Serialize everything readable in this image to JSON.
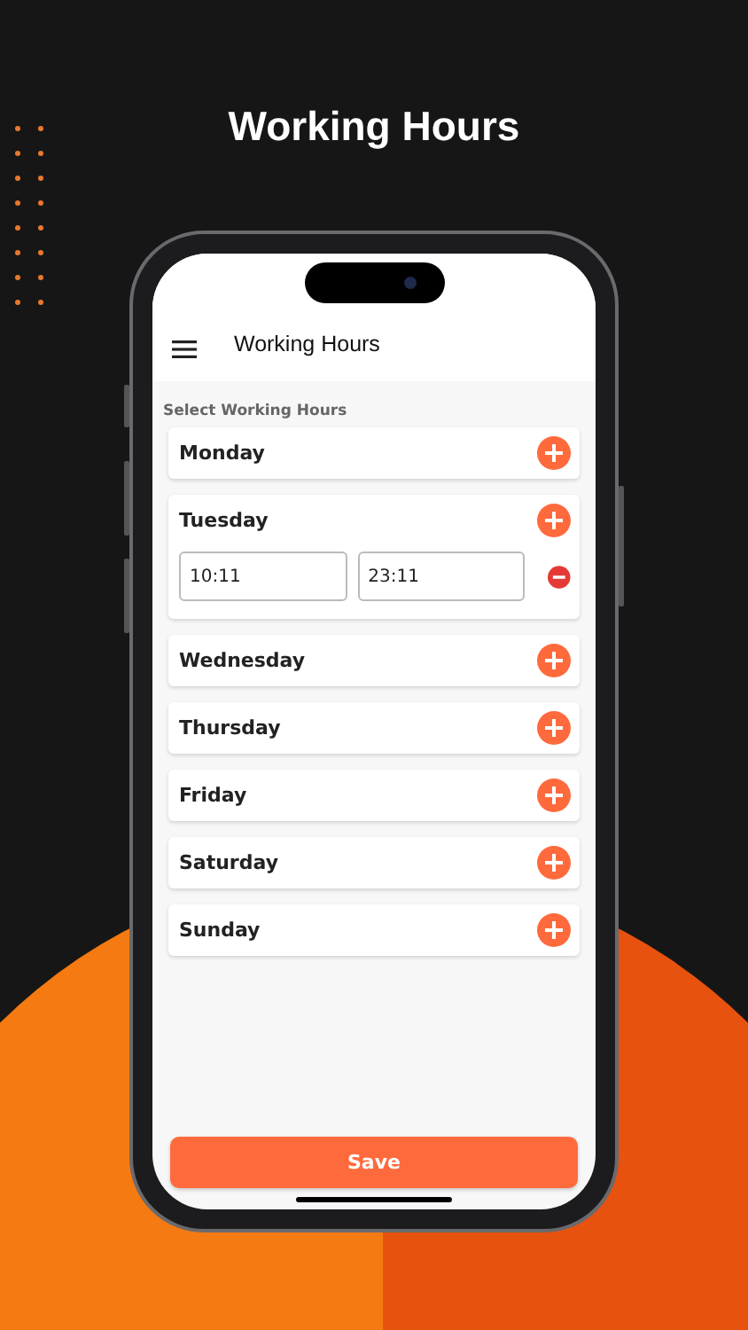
{
  "headline": "Working Hours",
  "app_bar": {
    "title": "Working Hours"
  },
  "section_label": "Select Working Hours",
  "days": [
    {
      "name": "Monday"
    },
    {
      "name": "Tuesday",
      "slots": [
        {
          "from": "10:11",
          "to": "23:11"
        }
      ]
    },
    {
      "name": "Wednesday"
    },
    {
      "name": "Thursday"
    },
    {
      "name": "Friday"
    },
    {
      "name": "Saturday"
    },
    {
      "name": "Sunday"
    }
  ],
  "save_button": "Save"
}
